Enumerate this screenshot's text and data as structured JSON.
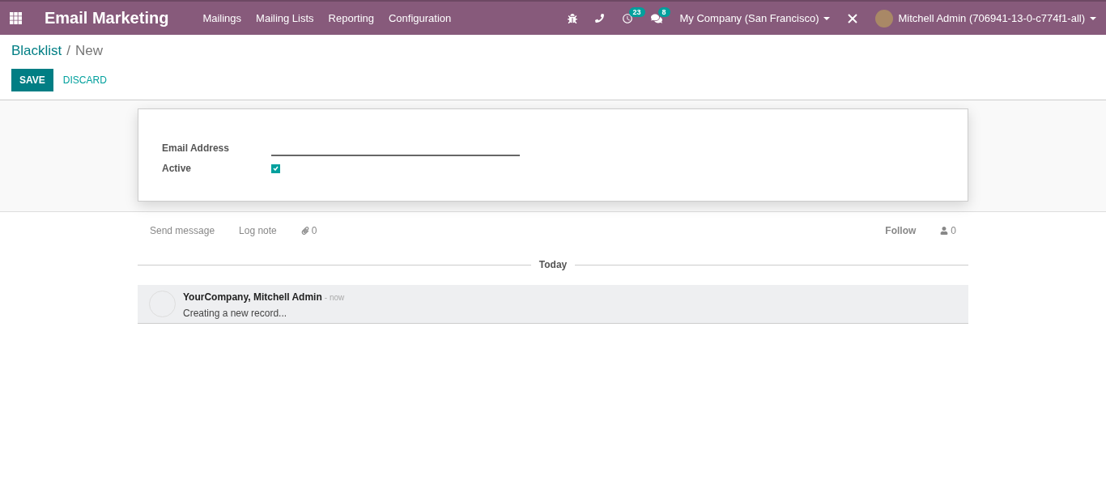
{
  "navbar": {
    "app_title": "Email Marketing",
    "menu": [
      "Mailings",
      "Mailing Lists",
      "Reporting",
      "Configuration"
    ],
    "activity_count": "23",
    "message_count": "8",
    "company": "My Company (San Francisco)",
    "user": "Mitchell Admin (706941-13-0-c774f1-all)"
  },
  "breadcrumb": {
    "parent": "Blacklist",
    "separator": "/",
    "current": "New"
  },
  "buttons": {
    "save": "SAVE",
    "discard": "DISCARD"
  },
  "form": {
    "fields": [
      {
        "kind": "text",
        "label": "Email Address"
      },
      {
        "kind": "checkbox",
        "label": "Active",
        "checked": true
      }
    ]
  },
  "chatter": {
    "send_message": "Send message",
    "log_note": "Log note",
    "attachments": "0",
    "follow": "Follow",
    "followers": "0",
    "date_separator": "Today",
    "messages": [
      {
        "author": "YourCompany, Mitchell Admin",
        "time": "- now",
        "body": "Creating a new record..."
      }
    ]
  }
}
